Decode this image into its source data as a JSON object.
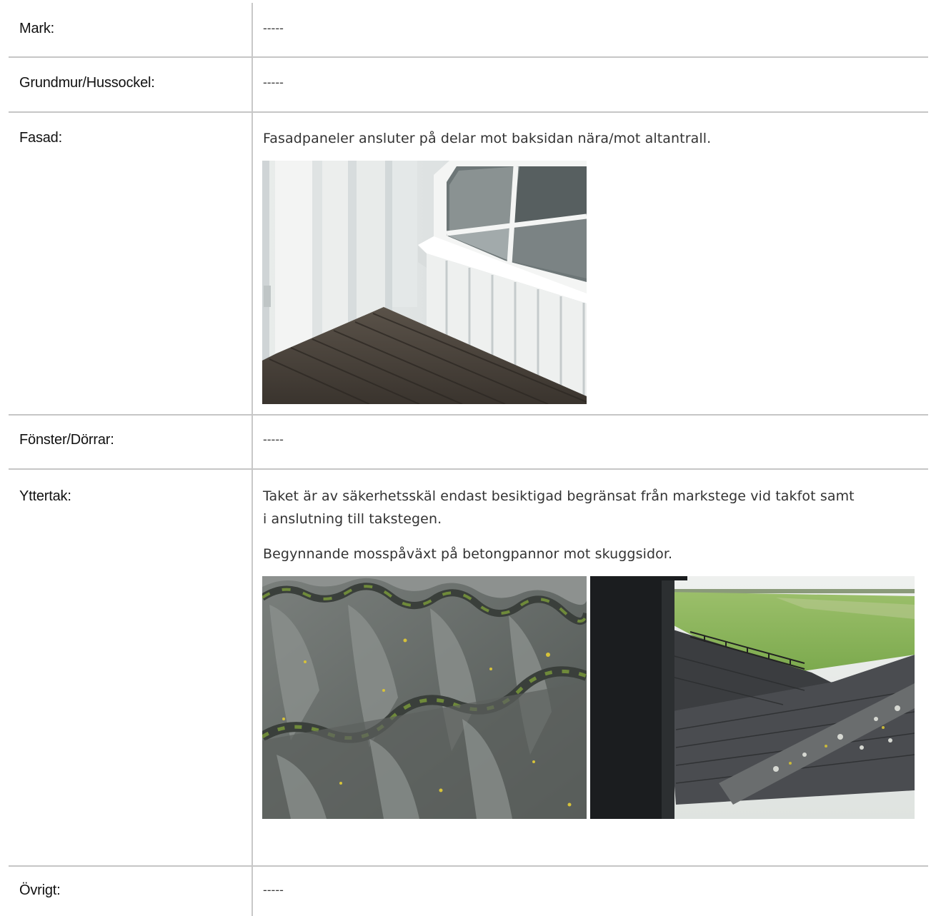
{
  "rows": [
    {
      "label": "Mark:",
      "value": "-----"
    },
    {
      "label": "Grundmur/Hussockel:",
      "value": "-----"
    },
    {
      "label": "Fasad:",
      "value": "Fasadpaneler ansluter på delar mot baksidan nära/mot altantrall."
    },
    {
      "label": "Fönster/Dörrar:",
      "value": "-----"
    },
    {
      "label": "Yttertak:",
      "value_line1": "Taket är av säkerhetsskäl endast besiktigad begränsat från markstege vid takfot samt",
      "value_line2": "i anslutning till takstegen.",
      "value_para2": "Begynnande mosspåväxt på betongpannor mot skuggsidor."
    },
    {
      "label": "Övrigt:",
      "value": "-----"
    }
  ],
  "photos": [
    {
      "name": "facade-photo",
      "subject": "white wood panel facade meeting dark deck boards below a window"
    },
    {
      "name": "roof-tiles-photo",
      "subject": "grey concrete roof tiles with moss growth"
    },
    {
      "name": "roof-overview-photo",
      "subject": "dark roof with chimney and roof ladder overlooking green field"
    }
  ]
}
